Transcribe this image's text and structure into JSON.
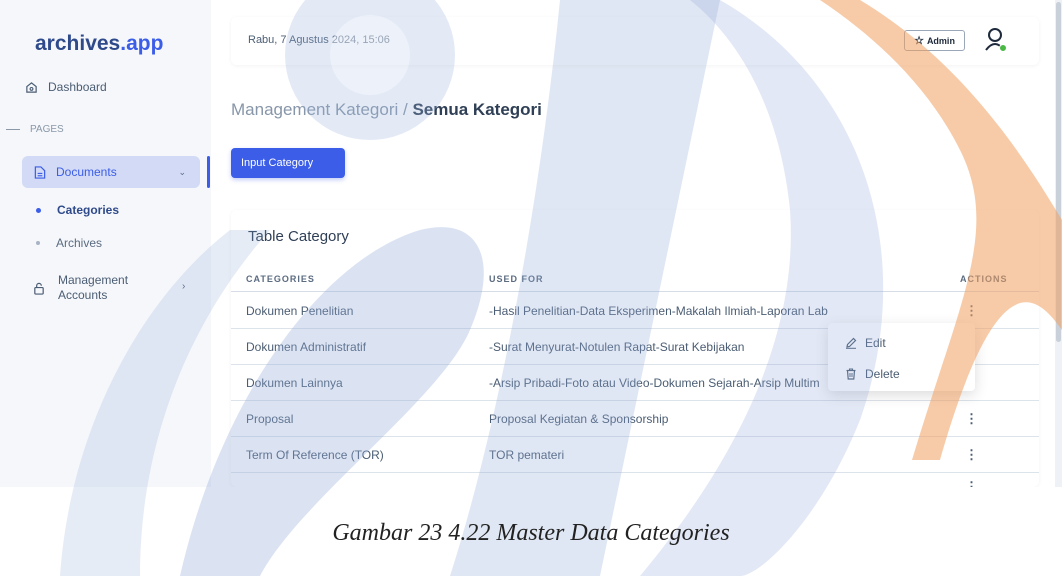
{
  "app": {
    "logo_main": "archives",
    "logo_accent": ".app"
  },
  "sidebar": {
    "dashboard": "Dashboard",
    "section": "PAGES",
    "documents": "Documents",
    "sub_items": [
      "Categories",
      "Archives"
    ],
    "management_line1": "Management",
    "management_line2": "Accounts"
  },
  "header": {
    "date": "Rabu, 7 Agustus 2024, 15:06",
    "role_badge": "Admin"
  },
  "page": {
    "breadcrumb_parent": "Management Kategori / ",
    "breadcrumb_current": "Semua Kategori",
    "input_button": "Input Category"
  },
  "table": {
    "title": "Table Category",
    "headers": [
      "CATEGORIES",
      "USED FOR",
      "ACTIONS"
    ],
    "rows": [
      [
        "Dokumen Penelitian",
        "-Hasil Penelitian-Data Eksperimen-Makalah Ilmiah-Laporan Lab"
      ],
      [
        "Dokumen Administratif",
        "-Surat Menyurat-Notulen Rapat-Surat Kebijakan"
      ],
      [
        "Dokumen Lainnya",
        "-Arsip Pribadi-Foto atau Video-Dokumen Sejarah-Arsip Multim"
      ],
      [
        "Proposal",
        "Proposal Kegiatan & Sponsorship"
      ],
      [
        "Term Of Reference (TOR)",
        "TOR pemateri"
      ]
    ],
    "actions_menu": [
      "Edit",
      "Delete"
    ]
  },
  "caption": "Gambar 23 4.22 Master Data Categories",
  "colors": {
    "accent": "#3b5de7",
    "watermark_orange": "#f0a060",
    "watermark_blue": "#8fa8d8"
  }
}
